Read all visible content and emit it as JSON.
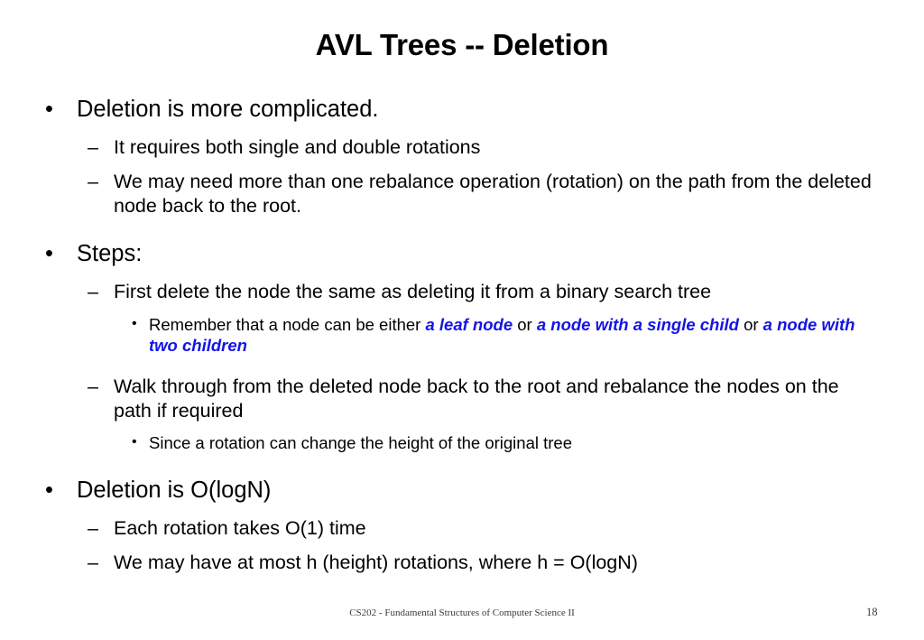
{
  "slide": {
    "title": "AVL Trees -- Deletion",
    "page_number": "18",
    "footer": "CS202 - Fundamental Structures of Computer Science II",
    "accent_blue": "#1414E6",
    "markers": {
      "level1": "•",
      "level2": "–",
      "level3": "•"
    }
  },
  "content": {
    "b1": {
      "text": "Deletion is more complicated.",
      "s1": "It requires both single and double rotations",
      "s2": "We may need more than one rebalance operation (rotation) on the path from the deleted node back to the root."
    },
    "b2": {
      "text": "Steps:",
      "s1": "First delete the node the same as deleting it from a binary search tree",
      "s1a_pre": "Remember that a node can be either ",
      "s1a_em1": "a leaf node",
      "s1a_mid1": " or ",
      "s1a_em2": "a node with a single child",
      "s1a_mid2": " or ",
      "s1a_em3": "a node with two children",
      "s2": "Walk through from the deleted node back to the root and rebalance the nodes on the path if required",
      "s2a": "Since a rotation can change the height of the original tree"
    },
    "b3": {
      "text": "Deletion is O(logN)",
      "s1": "Each rotation takes O(1) time",
      "s2": "We may have at most h (height) rotations, where h = O(logN)"
    }
  }
}
